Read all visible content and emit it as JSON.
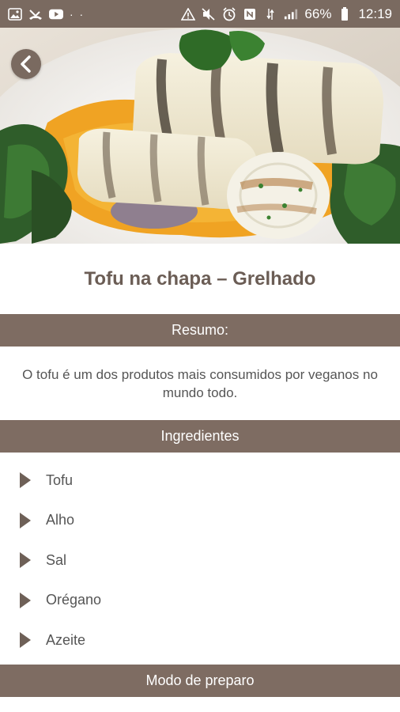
{
  "status_bar": {
    "battery": "66%",
    "time": "12:19",
    "dots": "· ·"
  },
  "recipe": {
    "title": "Tofu na chapa – Grelhado"
  },
  "summary_section": {
    "header": "Resumo:",
    "text": "O tofu é um dos produtos mais consumidos por veganos no mundo todo."
  },
  "ingredients_section": {
    "header": "Ingredientes",
    "items": [
      "Tofu",
      "Alho",
      "Sal",
      "Orégano",
      "Azeite"
    ]
  },
  "preparation_section": {
    "header": "Modo de preparo"
  },
  "colors": {
    "accent_brown": "#7e6c62",
    "title_text": "#6b5d55",
    "body_text": "#555555"
  }
}
